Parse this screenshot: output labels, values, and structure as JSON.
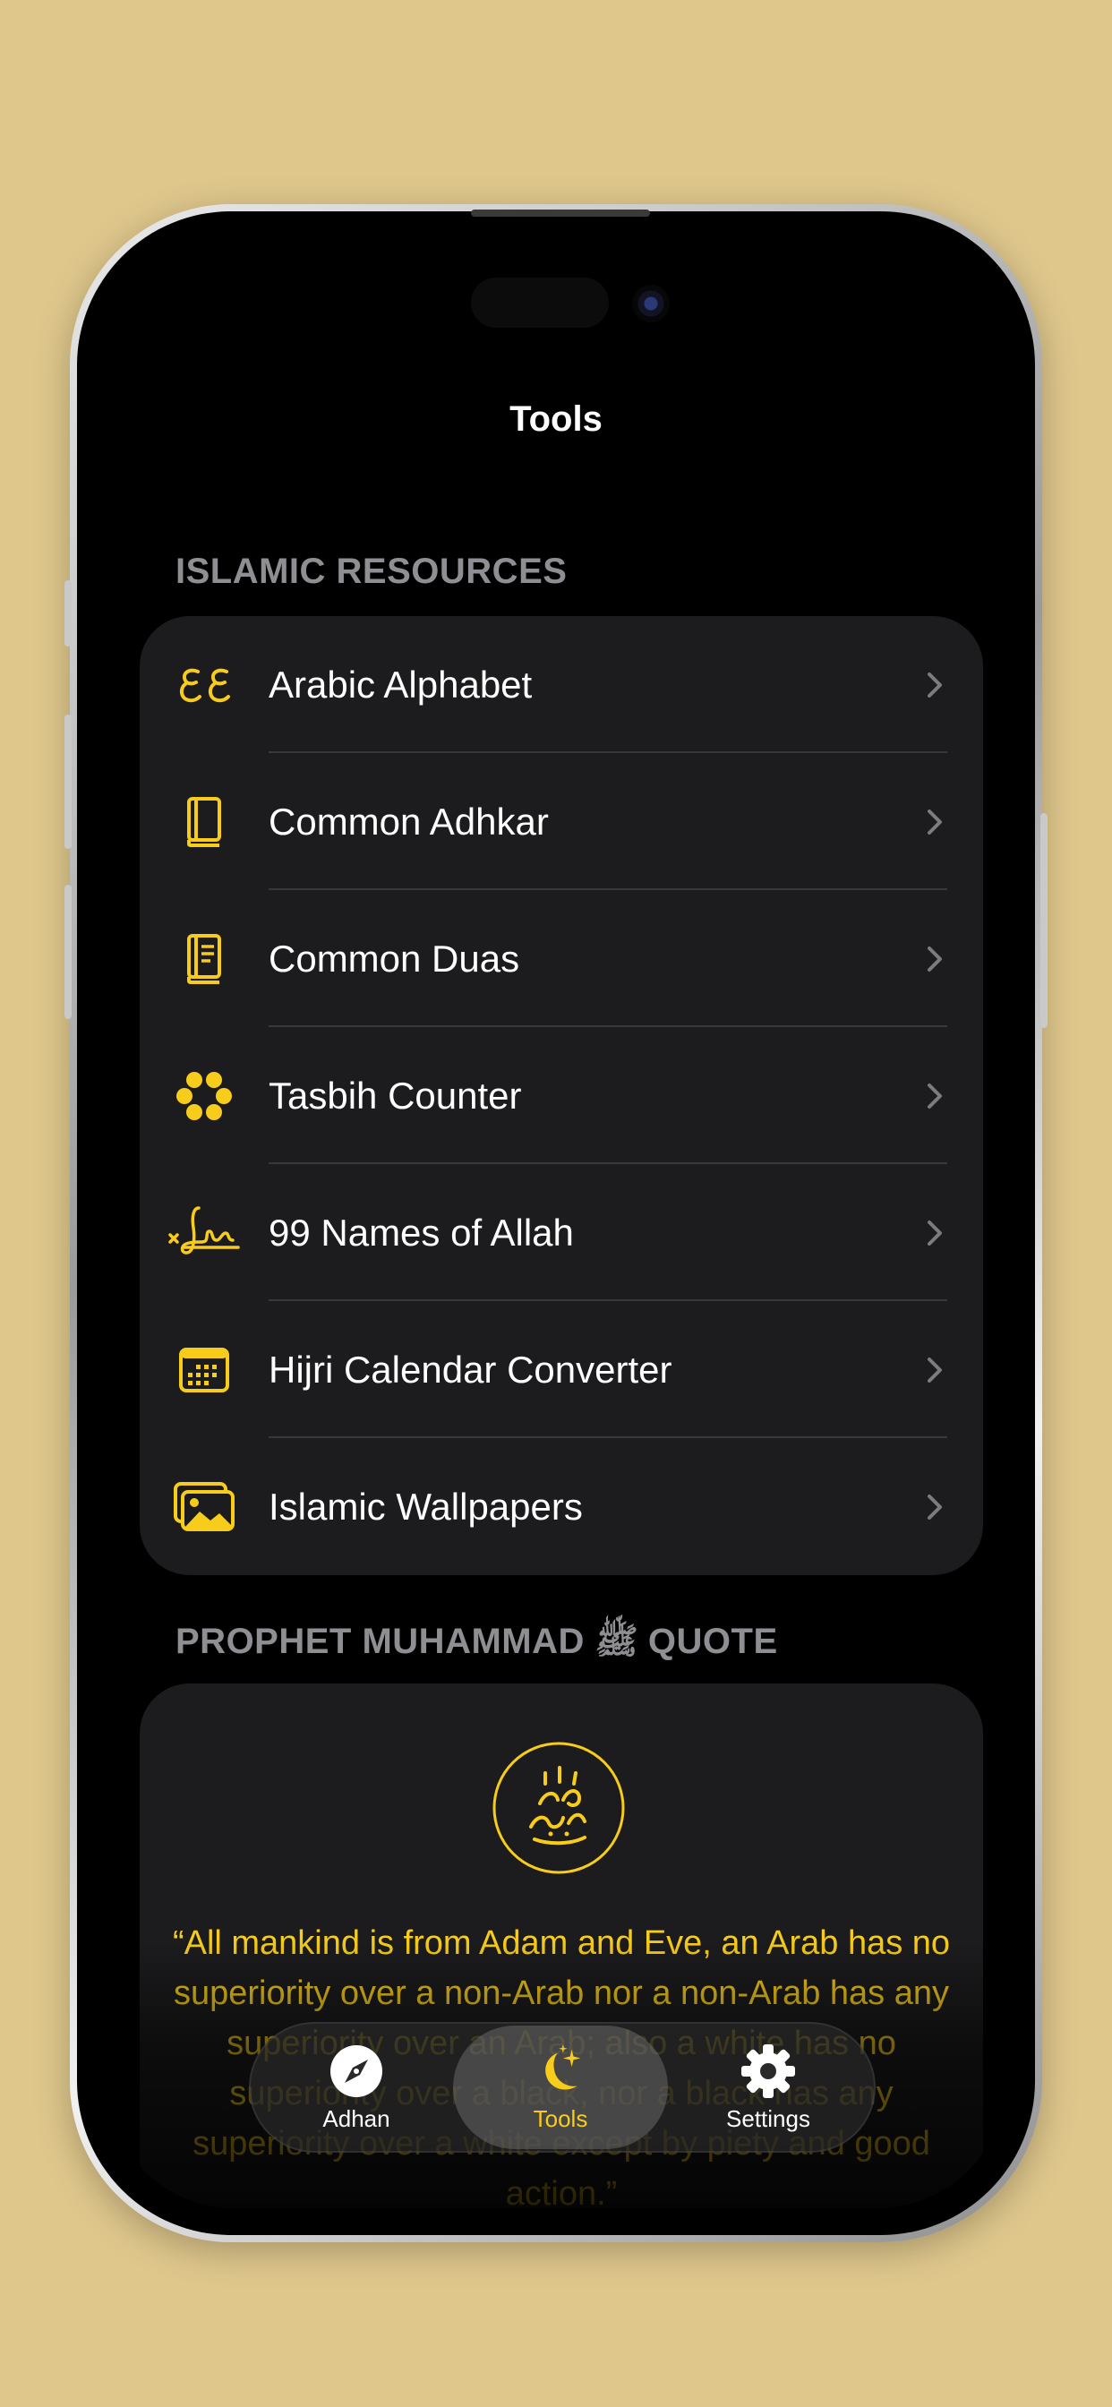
{
  "screen": {
    "title": "Tools"
  },
  "sections": {
    "resources_header": "ISLAMIC RESOURCES",
    "quote_header": "PROPHET MUHAMMAD ﷺ QUOTE"
  },
  "resources": [
    {
      "label": "Arabic Alphabet",
      "icon": "arabic-letters-icon"
    },
    {
      "label": "Common Adhkar",
      "icon": "book-icon"
    },
    {
      "label": "Common Duas",
      "icon": "book-pages-icon"
    },
    {
      "label": "Tasbih Counter",
      "icon": "tasbih-beads-icon"
    },
    {
      "label": "99 Names of Allah",
      "icon": "signature-icon"
    },
    {
      "label": "Hijri Calendar Converter",
      "icon": "calendar-icon"
    },
    {
      "label": "Islamic Wallpapers",
      "icon": "photos-icon"
    }
  ],
  "quote": {
    "text": "“All mankind is from Adam and Eve, an Arab has no superiority over a non-Arab nor a non-Arab has any superiority over an Arab; also a white has no superiority over a black, nor a black has any superiority over a white except by piety and good action.”"
  },
  "tabbar": {
    "tabs": [
      {
        "label": "Adhan",
        "icon": "compass-icon"
      },
      {
        "label": "Tools",
        "icon": "moon-stars-icon",
        "active": true
      },
      {
        "label": "Settings",
        "icon": "gear-icon"
      }
    ]
  },
  "colors": {
    "accent": "#f7cc1a",
    "background": "#000000",
    "card": "#1c1c1e",
    "secondary_text": "#8e8e93",
    "page_background": "#dfc78c"
  }
}
